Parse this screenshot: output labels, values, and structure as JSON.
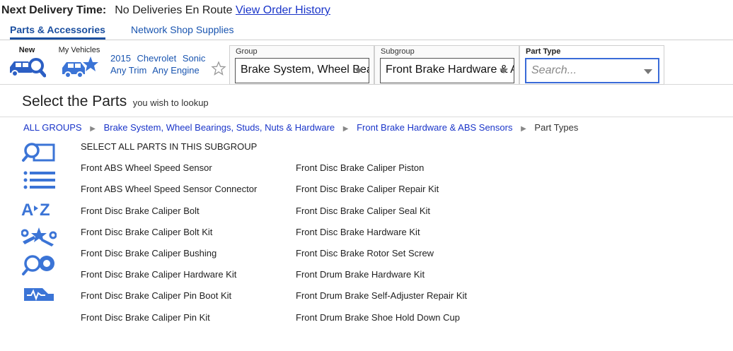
{
  "delivery": {
    "label": "Next Delivery Time:",
    "value": "No Deliveries En Route",
    "link": "View Order History"
  },
  "tabs": [
    {
      "label": "Parts & Accessories",
      "active": true
    },
    {
      "label": "Network Shop Supplies",
      "active": false
    }
  ],
  "vehicle_bar": {
    "new_label": "New",
    "my_vehicles_label": "My Vehicles",
    "year": "2015",
    "make": "Chevrolet",
    "model": "Sonic",
    "trim": "Any Trim",
    "engine": "Any Engine"
  },
  "selectors": {
    "group": {
      "label": "Group",
      "value": "Brake System, Wheel Bearings, Studs, Nuts & Hardware"
    },
    "subgroup": {
      "label": "Subgroup",
      "value": "Front Brake Hardware & ABS Sensors"
    },
    "part_type": {
      "label": "Part Type",
      "placeholder": "Search..."
    }
  },
  "title": {
    "main": "Select the Parts",
    "sub": "you wish to lookup"
  },
  "breadcrumb": {
    "items": [
      "ALL GROUPS",
      "Brake System, Wheel Bearings, Studs, Nuts & Hardware",
      "Front Brake Hardware & ABS Sensors"
    ],
    "current": "Part Types"
  },
  "side_icons": [
    "lookup-icon",
    "list-icon",
    "az-sort-icon",
    "tools-star-icon",
    "tire-search-icon",
    "diagnostic-car-icon"
  ],
  "parts": {
    "select_all": "SELECT ALL PARTS IN THIS SUBGROUP",
    "col1": [
      "Front ABS Wheel Speed Sensor",
      "Front ABS Wheel Speed Sensor Connector",
      "Front Disc Brake Caliper Bolt",
      "Front Disc Brake Caliper Bolt Kit",
      "Front Disc Brake Caliper Bushing",
      "Front Disc Brake Caliper Hardware Kit",
      "Front Disc Brake Caliper Pin Boot Kit",
      "Front Disc Brake Caliper Pin Kit"
    ],
    "col2": [
      "Front Disc Brake Caliper Piston",
      "Front Disc Brake Caliper Repair Kit",
      "Front Disc Brake Caliper Seal Kit",
      "Front Disc Brake Hardware Kit",
      "Front Disc Brake Rotor Set Screw",
      "Front Drum Brake Hardware Kit",
      "Front Drum Brake Self-Adjuster Repair Kit",
      "Front Drum Brake Shoe Hold Down Cup"
    ]
  },
  "colors": {
    "accent": "#1b4fa0",
    "link": "#1a35c9",
    "icon": "#3b74d6"
  }
}
